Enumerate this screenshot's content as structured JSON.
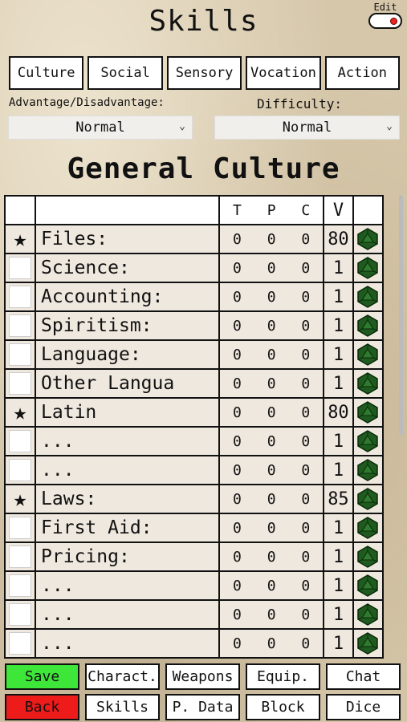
{
  "header": {
    "title": "Skills",
    "edit_label": "Edit"
  },
  "category_tabs": [
    "Culture",
    "Social",
    "Sensory",
    "Vocation",
    "Action"
  ],
  "selectors": {
    "advantage": {
      "label": "Advantage/Disadvantage:",
      "value": "Normal"
    },
    "difficulty": {
      "label": "Difficulty:",
      "value": "Normal"
    }
  },
  "section_title": "General Culture",
  "table": {
    "headers": {
      "t": "T",
      "p": "P",
      "c": "C",
      "v": "V"
    },
    "rows": [
      {
        "star": true,
        "name": "Files:",
        "t": "0",
        "p": "0",
        "c": "0",
        "v": "80"
      },
      {
        "star": false,
        "name": "Science:",
        "t": "0",
        "p": "0",
        "c": "0",
        "v": "1"
      },
      {
        "star": false,
        "name": "Accounting:",
        "t": "0",
        "p": "0",
        "c": "0",
        "v": "1"
      },
      {
        "star": false,
        "name": "Spiritism:",
        "t": "0",
        "p": "0",
        "c": "0",
        "v": "1"
      },
      {
        "star": false,
        "name": "Language:",
        "t": "0",
        "p": "0",
        "c": "0",
        "v": "1"
      },
      {
        "star": false,
        "name": "Other Langua",
        "t": "0",
        "p": "0",
        "c": "0",
        "v": "1"
      },
      {
        "star": true,
        "name": "Latin",
        "t": "0",
        "p": "0",
        "c": "0",
        "v": "80"
      },
      {
        "star": false,
        "name": "...",
        "t": "0",
        "p": "0",
        "c": "0",
        "v": "1"
      },
      {
        "star": false,
        "name": "...",
        "t": "0",
        "p": "0",
        "c": "0",
        "v": "1"
      },
      {
        "star": true,
        "name": "Laws:",
        "t": "0",
        "p": "0",
        "c": "0",
        "v": "85"
      },
      {
        "star": false,
        "name": "First Aid:",
        "t": "0",
        "p": "0",
        "c": "0",
        "v": "1"
      },
      {
        "star": false,
        "name": "Pricing:",
        "t": "0",
        "p": "0",
        "c": "0",
        "v": "1"
      },
      {
        "star": false,
        "name": "...",
        "t": "0",
        "p": "0",
        "c": "0",
        "v": "1"
      },
      {
        "star": false,
        "name": "...",
        "t": "0",
        "p": "0",
        "c": "0",
        "v": "1"
      },
      {
        "star": false,
        "name": "...",
        "t": "0",
        "p": "0",
        "c": "0",
        "v": "1"
      }
    ]
  },
  "bottom_nav": {
    "row1": [
      "Save",
      "Charact.",
      "Weapons",
      "Equip.",
      "Chat"
    ],
    "row2": [
      "Back",
      "Skills",
      "P. Data",
      "Block",
      "Dice"
    ]
  },
  "colors": {
    "save": "#3fe63a",
    "back": "#ee1b1b",
    "die": "#1f5a1f",
    "toggle_knob": "#e22222"
  },
  "icons": {
    "favorite": "star-icon",
    "roll": "d20-die-icon",
    "dropdown": "chevron-down-icon"
  }
}
